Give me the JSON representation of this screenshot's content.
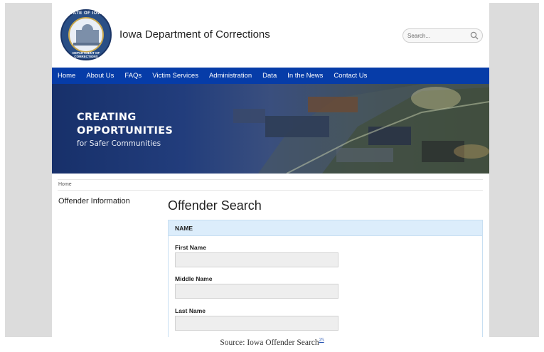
{
  "header": {
    "seal_top_text": "STATE OF IOWA",
    "seal_bottom_text": "DEPARTMENT OF CORRECTIONS",
    "title": "Iowa Department of Corrections",
    "search_placeholder": "Search..."
  },
  "nav": {
    "items": [
      "Home",
      "About Us",
      "FAQs",
      "Victim Services",
      "Administration",
      "Data",
      "In the News",
      "Contact Us"
    ]
  },
  "banner": {
    "line1": "CREATING",
    "line2": "OPPORTUNITIES",
    "line3": "for Safer Communities"
  },
  "breadcrumb": {
    "home": "Home"
  },
  "sidebar": {
    "title": "Offender Information"
  },
  "main": {
    "title": "Offender Search",
    "section_title": "NAME",
    "fields": [
      {
        "label": "First Name",
        "value": ""
      },
      {
        "label": "Middle Name",
        "value": ""
      },
      {
        "label": "Last Name",
        "value": ""
      }
    ]
  },
  "caption": {
    "text": "Source: Iowa Offender Search",
    "footnote": "25"
  },
  "colors": {
    "nav": "#063ca8",
    "section_header": "#dcedfb",
    "background": "#dcdcdc"
  }
}
